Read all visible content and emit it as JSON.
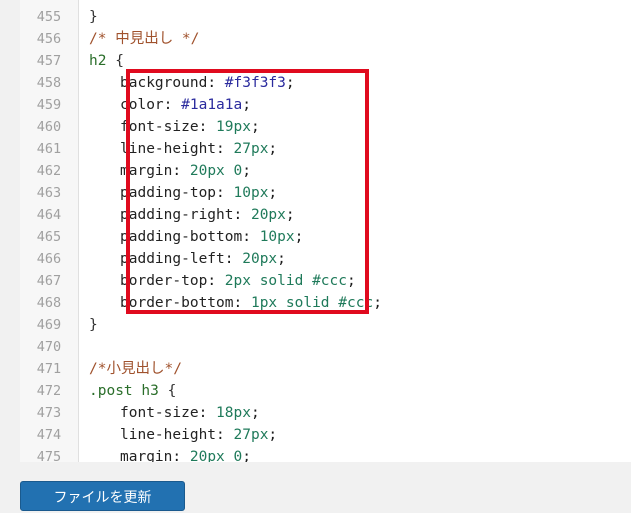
{
  "editor": {
    "lines": [
      {
        "num": "455",
        "code": "}"
      },
      {
        "num": "456",
        "code": "",
        "comment": "/* 中見出し */"
      },
      {
        "num": "457",
        "selector": "h2",
        "code": " {"
      },
      {
        "num": "458",
        "prop": "background",
        "value": "#f3f3f3"
      },
      {
        "num": "459",
        "prop": "color",
        "value": "#1a1a1a"
      },
      {
        "num": "460",
        "prop": "font-size",
        "value": "19px"
      },
      {
        "num": "461",
        "prop": "line-height",
        "value": "27px"
      },
      {
        "num": "462",
        "prop": "margin",
        "value": "20px 0"
      },
      {
        "num": "463",
        "prop": "padding-top",
        "value": "10px"
      },
      {
        "num": "464",
        "prop": "padding-right",
        "value": "20px"
      },
      {
        "num": "465",
        "prop": "padding-bottom",
        "value": "10px"
      },
      {
        "num": "466",
        "prop": "padding-left",
        "value": "20px"
      },
      {
        "num": "467",
        "prop": "border-top",
        "value": "2px solid #ccc"
      },
      {
        "num": "468",
        "prop": "border-bottom",
        "value": "1px solid #ccc"
      },
      {
        "num": "469",
        "code": "}"
      },
      {
        "num": "470",
        "code": ""
      },
      {
        "num": "471",
        "comment": "/*小見出し*/"
      },
      {
        "num": "472",
        "selector": ".post h3",
        "code": " {"
      },
      {
        "num": "473",
        "prop": "font-size",
        "value": "18px"
      },
      {
        "num": "474",
        "prop": "line-height",
        "value": "27px"
      },
      {
        "num": "475",
        "prop": "margin",
        "value": "20px 0"
      }
    ]
  },
  "footer": {
    "update_button_label": "ファイルを更新"
  },
  "colors": {
    "highlight_border": "#e00a1e",
    "button_bg": "#2271b1"
  }
}
